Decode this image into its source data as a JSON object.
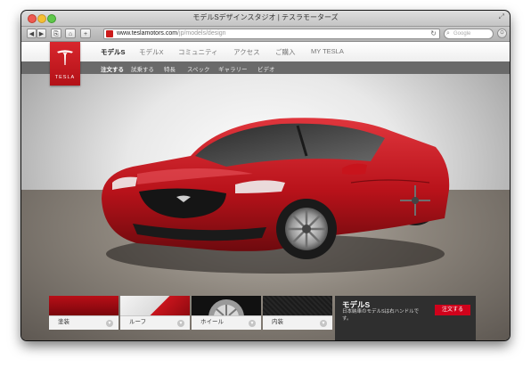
{
  "window": {
    "title": "モデルSデザインスタジオ | テスラモーターズ"
  },
  "toolbar": {
    "url_host": "www.teslamotors.com",
    "url_path": "/jp/models/design",
    "search_placeholder": "Google"
  },
  "brand": {
    "logo_text": "TESLA",
    "color": "#cc1b1b"
  },
  "nav": {
    "items": [
      {
        "label": "モデルS",
        "active": true
      },
      {
        "label": "モデルX",
        "active": false
      },
      {
        "label": "コミュニティ",
        "active": false
      },
      {
        "label": "アクセス",
        "active": false
      },
      {
        "label": "ご購入",
        "active": false
      },
      {
        "label": "MY TESLA",
        "active": false
      }
    ]
  },
  "subnav": {
    "items": [
      {
        "label": "注文する",
        "active": true
      },
      {
        "label": "試乗する"
      },
      {
        "label": "特長"
      },
      {
        "label": "スペック"
      },
      {
        "label": "ギャラリー"
      },
      {
        "label": "ビデオ"
      }
    ]
  },
  "options": [
    {
      "label": "塗装"
    },
    {
      "label": "ルーフ"
    },
    {
      "label": "ホイール"
    },
    {
      "label": "内装"
    }
  ],
  "panel": {
    "title": "モデルS",
    "description": "日本納車のモデルSは右ハンドルです。",
    "order_label": "注文する",
    "accent_color": "#d0021b"
  },
  "car": {
    "paint_color": "#c8141c"
  }
}
